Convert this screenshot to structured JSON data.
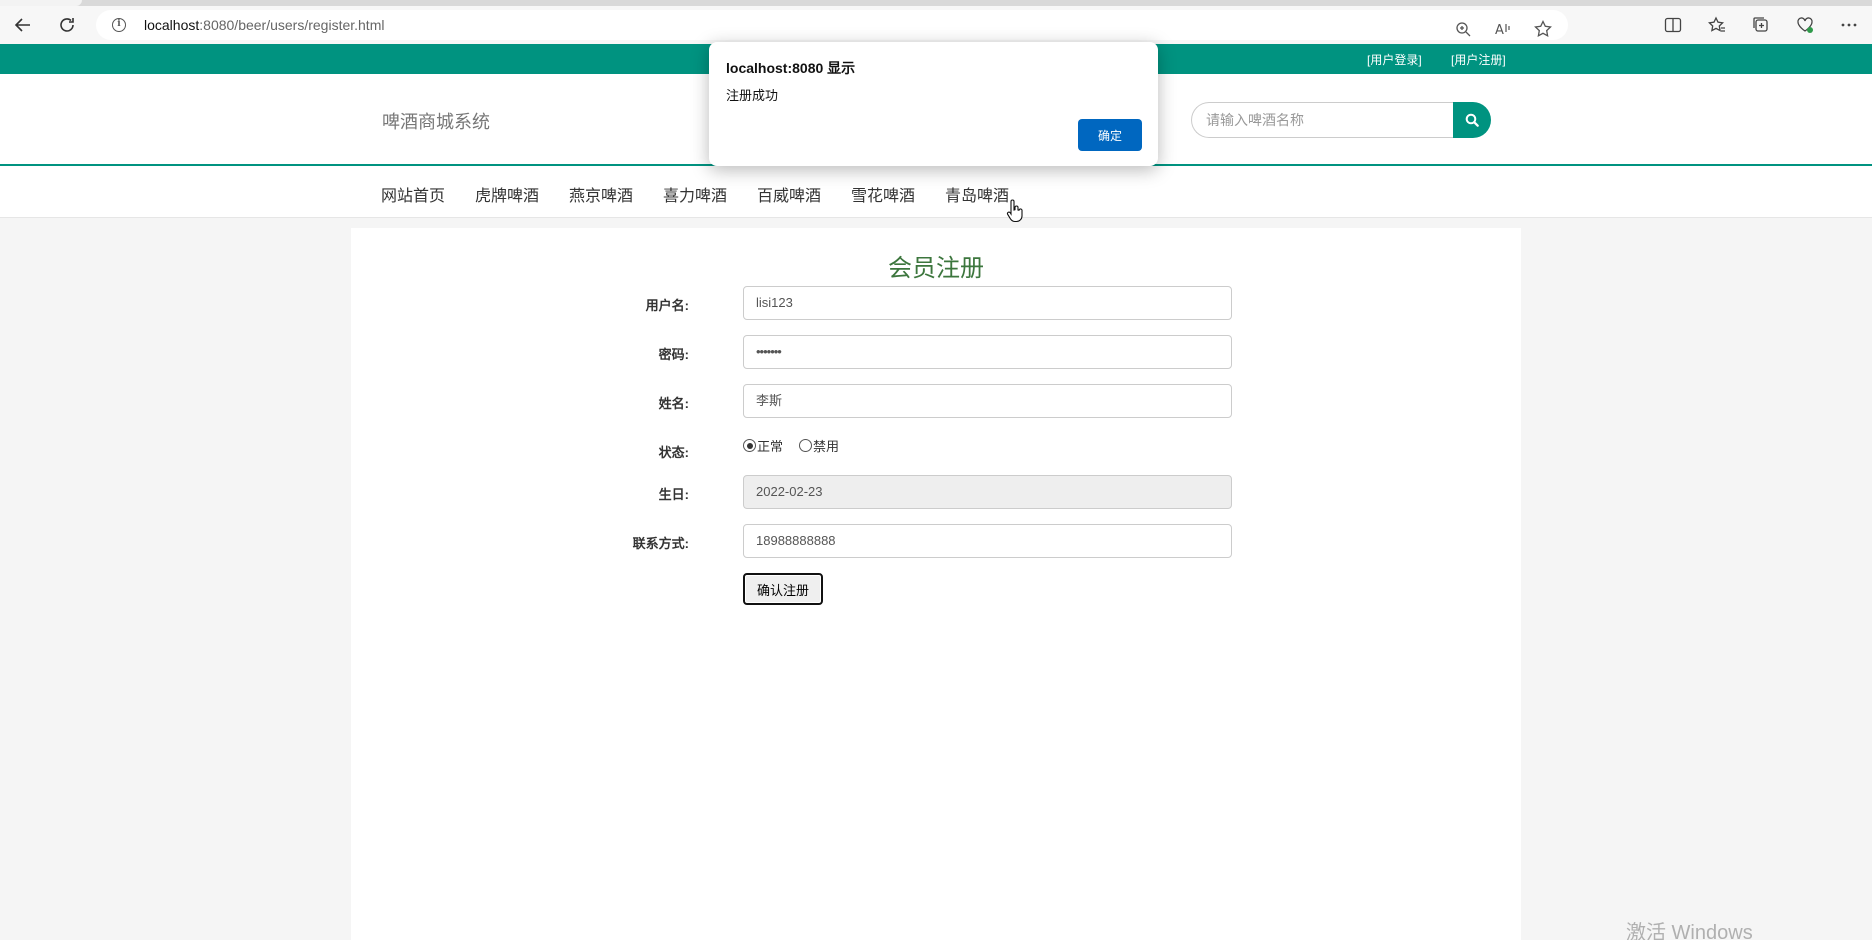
{
  "browser": {
    "url_host": "localhost",
    "url_rest": ":8080/beer/users/register.html"
  },
  "site": {
    "top_links": [
      "[用户登录]",
      "[用户注册]"
    ],
    "logo": "啤酒商城系统",
    "search_placeholder": "请输入啤酒名称",
    "nav": [
      "网站首页",
      "虎牌啤酒",
      "燕京啤酒",
      "喜力啤酒",
      "百威啤酒",
      "雪花啤酒",
      "青岛啤酒"
    ]
  },
  "form": {
    "title": "会员注册",
    "username_label": "用户名:",
    "username_value": "lisi123",
    "password_label": "密码:",
    "password_value": "•••••••",
    "name_label": "姓名:",
    "name_value": "李斯",
    "status_label": "状态:",
    "status_options": [
      "正常",
      "禁用"
    ],
    "status_selected": "正常",
    "birthday_label": "生日:",
    "birthday_value": "2022-02-23",
    "phone_label": "联系方式:",
    "phone_value": "18988888888",
    "submit_label": "确认注册"
  },
  "dialog": {
    "title": "localhost:8080 显示",
    "message": "注册成功",
    "ok_label": "确定"
  },
  "watermark": "激活 Windows",
  "colors": {
    "brand": "#009380",
    "title_green": "#3c763d",
    "dialog_button": "#0067c0"
  }
}
